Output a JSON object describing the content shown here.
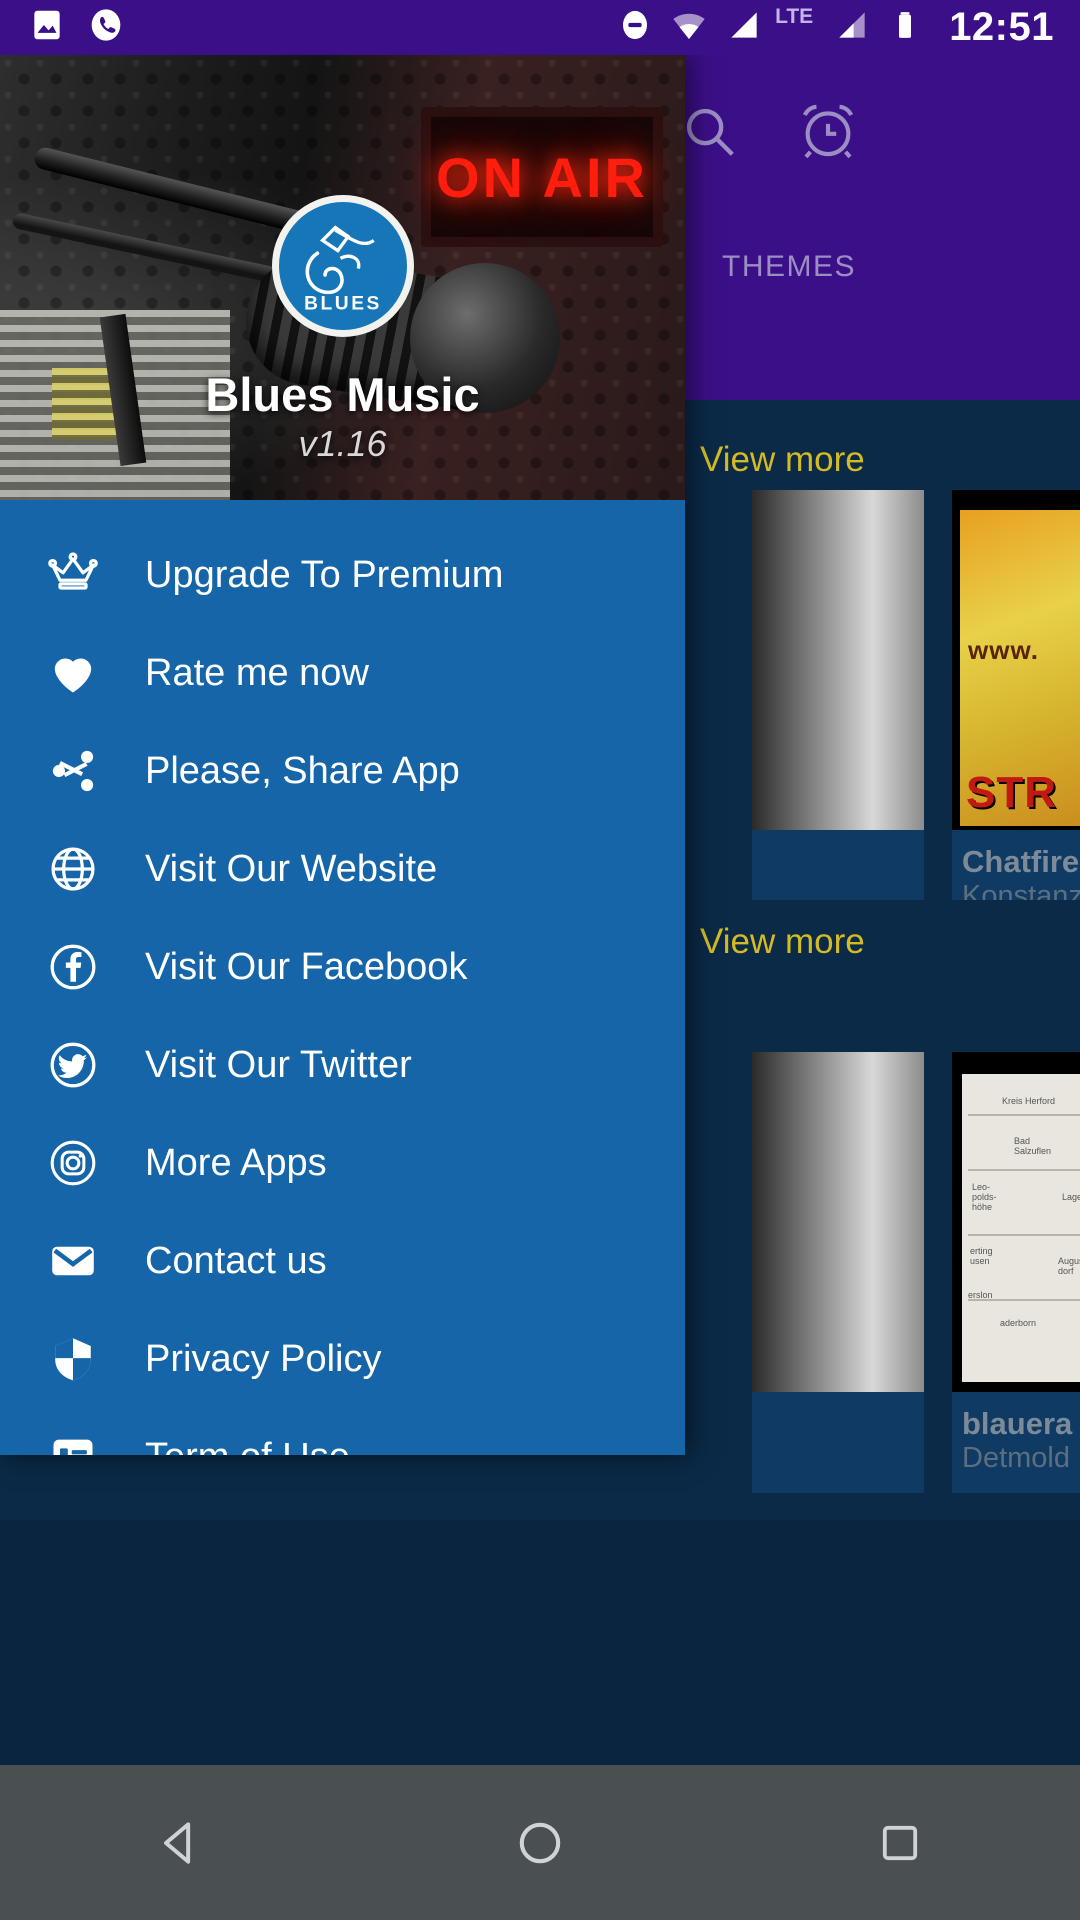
{
  "status_bar": {
    "time": "12:51",
    "left_icons": [
      "image-icon",
      "phone-call-icon"
    ],
    "right_icons": [
      "do-not-disturb-icon",
      "wifi-icon",
      "signal-icon",
      "signal-icon-2",
      "battery-icon"
    ],
    "network_label": "LTE",
    "background_color": "#3b0f87"
  },
  "background_app": {
    "appbar": {
      "background_color": "#3b0f87",
      "search_icon": "search-icon",
      "alarm_icon": "alarm-clock-icon"
    },
    "tabs": [
      {
        "label": "THEMES",
        "selected": false
      }
    ],
    "sections": [
      {
        "view_more_label": "View more",
        "cards": [
          {
            "title": "",
            "subtitle": "",
            "art": "gray"
          },
          {
            "title": "Chatfire",
            "subtitle": "Konstanz",
            "art": "yellow",
            "art_text_top": "www.",
            "art_text_bottom": "STR"
          }
        ]
      },
      {
        "view_more_label": "View more",
        "cards": [
          {
            "title": "",
            "subtitle": "",
            "art": "gray"
          },
          {
            "title": "blauera",
            "subtitle": "Detmold",
            "art": "map"
          }
        ]
      }
    ],
    "accent_link_color": "#d4bb22",
    "content_background": "#0a2a47"
  },
  "drawer": {
    "background_color": "#1565a8",
    "header": {
      "app_name": "Blues Music",
      "version": "v1.16",
      "logo_text": "BLUES",
      "logo_color": "#1676b8",
      "on_air_sign": "ON AIR",
      "background_image": "radio-studio-microphone-photo"
    },
    "items": [
      {
        "label": "Upgrade To Premium",
        "icon": "crown-icon"
      },
      {
        "label": "Rate me now",
        "icon": "heart-icon"
      },
      {
        "label": "Please, Share App",
        "icon": "share-icon"
      },
      {
        "label": "Visit Our Website",
        "icon": "globe-icon"
      },
      {
        "label": "Visit Our Facebook",
        "icon": "facebook-icon"
      },
      {
        "label": "Visit Our Twitter",
        "icon": "twitter-icon"
      },
      {
        "label": "More Apps",
        "icon": "instagram-icon"
      },
      {
        "label": "Contact us",
        "icon": "envelope-icon"
      },
      {
        "label": "Privacy Policy",
        "icon": "shield-icon"
      },
      {
        "label": "Term of Use",
        "icon": "list-document-icon"
      }
    ]
  },
  "nav_bar": {
    "background_color": "#4a4f52",
    "buttons": [
      {
        "name": "back-button",
        "icon": "triangle-back-icon"
      },
      {
        "name": "home-button",
        "icon": "circle-home-icon"
      },
      {
        "name": "recents-button",
        "icon": "square-recents-icon"
      }
    ]
  }
}
